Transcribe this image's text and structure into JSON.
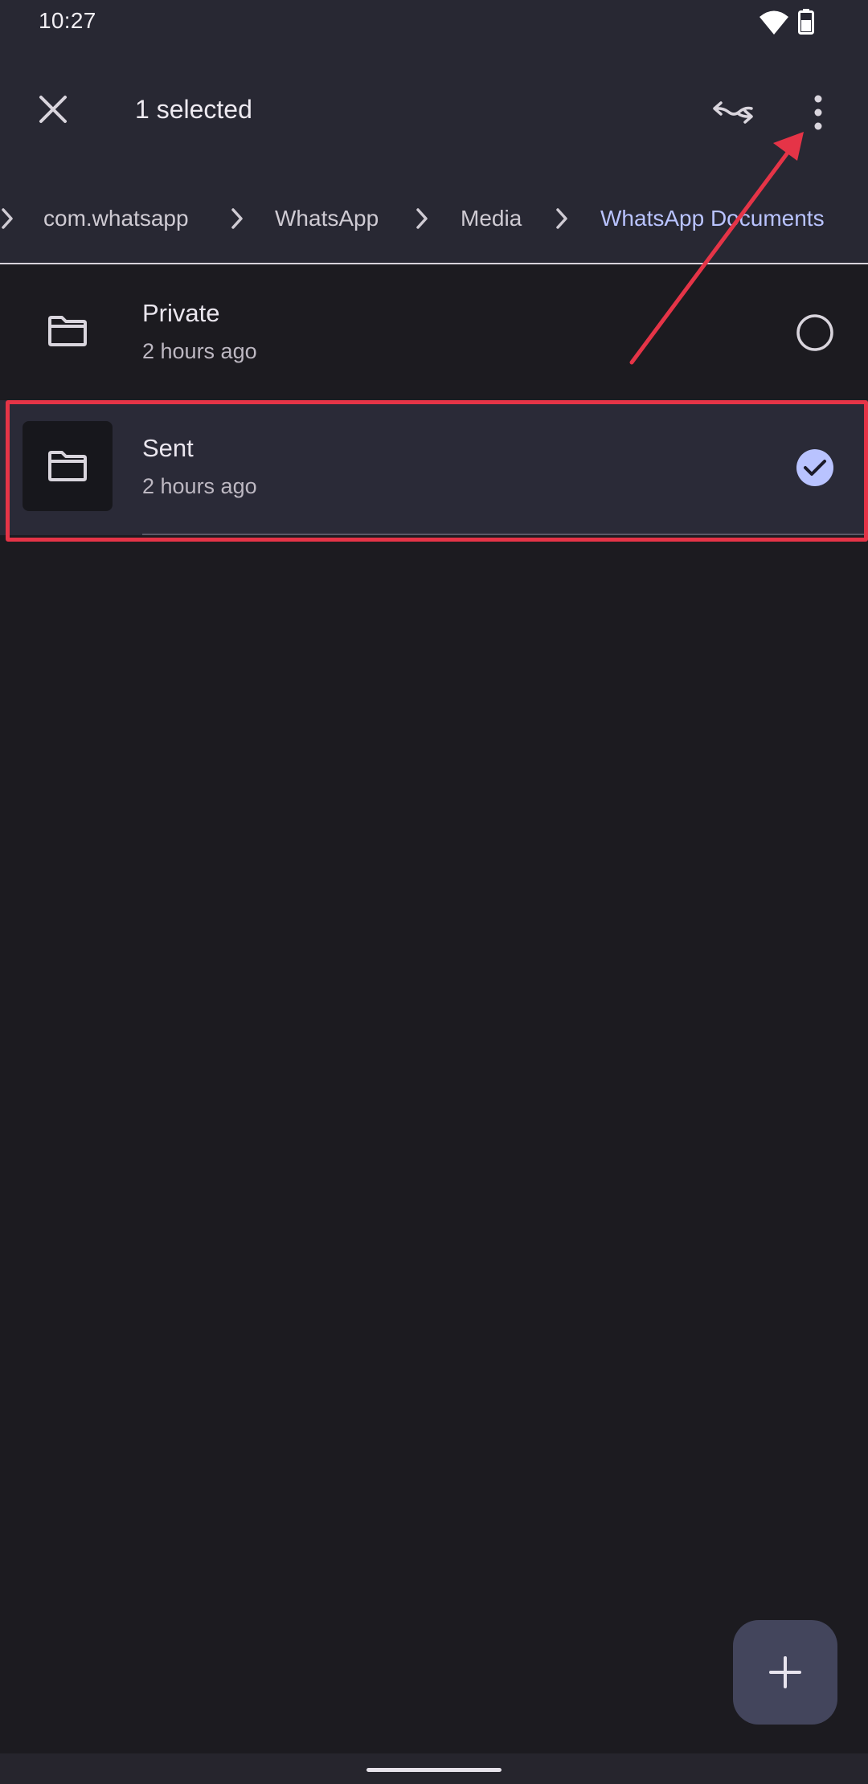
{
  "status_bar": {
    "time": "10:27",
    "icons": [
      "wifi-icon",
      "battery-icon"
    ]
  },
  "action_bar": {
    "close_icon": "close-icon",
    "title": "1 selected",
    "select_all_icon": "select-all-icon",
    "more_icon": "more-vert-icon"
  },
  "breadcrumb": {
    "items": [
      {
        "label": "com.whatsapp",
        "current": false
      },
      {
        "label": "WhatsApp",
        "current": false
      },
      {
        "label": "Media",
        "current": false
      },
      {
        "label": "WhatsApp Documents",
        "current": true
      }
    ]
  },
  "files": [
    {
      "name": "Private",
      "modified": "2 hours ago",
      "selected": false,
      "icon": "folder-icon"
    },
    {
      "name": "Sent",
      "modified": "2 hours ago",
      "selected": true,
      "icon": "folder-icon"
    }
  ],
  "fab": {
    "icon": "add-icon"
  },
  "colors": {
    "accent": "#b9c3ff",
    "annotation": "#e53447",
    "background": "#1c1b20",
    "top_bar": "#282833"
  }
}
